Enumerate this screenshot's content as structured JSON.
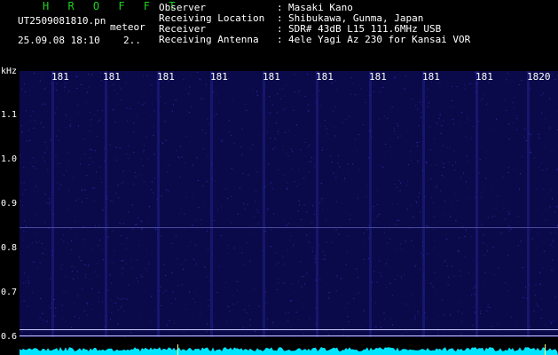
{
  "header": {
    "app_title": "H R O F F T",
    "filename": "UT2509081810.pn",
    "tag": "meteor",
    "datetime": "25.09.08 18:10",
    "count": "2..",
    "info": [
      {
        "key": "Observer",
        "value": "Masaki Kano"
      },
      {
        "key": "Receiving Location",
        "value": "Shibukawa, Gunma, Japan"
      },
      {
        "key": "Receiver",
        "value": "SDR# 43dB L15 111.6MHz USB"
      },
      {
        "key": "Receiving Antenna",
        "value": "4ele Yagi Az 230 for Kansai VOR"
      }
    ]
  },
  "axis": {
    "y_unit": "kHz",
    "x_ticks": [
      "181",
      "181",
      "181",
      "181",
      "181",
      "181",
      "181",
      "181",
      "181",
      "1820"
    ],
    "y_ticks": [
      "1.1",
      "1.0",
      "0.9",
      "0.8",
      "0.7",
      "0.6"
    ]
  },
  "colors": {
    "background": "#000000",
    "spectrogram": "#0a0a4a",
    "title": "#1fd11f",
    "trace": "#00e5ff"
  }
}
